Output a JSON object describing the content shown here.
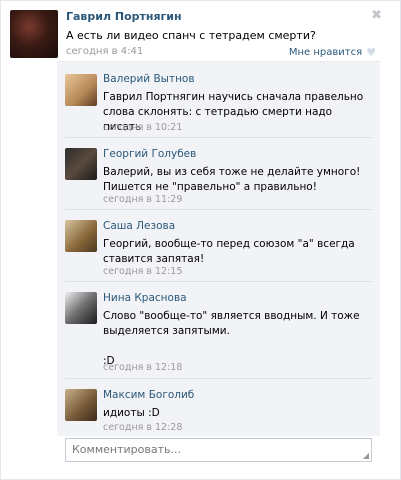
{
  "post": {
    "author": "Гаврил Портнягин",
    "text": "А есть ли видео спанч с тетрадем смерти?",
    "date": "сегодня в 4:41",
    "like_label": "Мне нравится",
    "close_glyph": "✖",
    "heart_glyph": "♥"
  },
  "comments": [
    {
      "author": "Валерий Вытнов",
      "text": "Гаврил Портнягин научись сначала правельно слова склонять: с тетрадью смерти надо писать",
      "date": "сегодня в 10:21"
    },
    {
      "author": "Георгий Голубев",
      "text": "Валерий, вы из себя тоже не делайте умного!\nПишется не \"правельно\" а правильно!",
      "date": "сегодня в 11:29"
    },
    {
      "author": "Саша Лезова",
      "text": "Георгий, вообще-то перед союзом \"а\" всегда ставится запятая!",
      "date": "сегодня в 12:15"
    },
    {
      "author": "Нина Краснова",
      "text": "Слово \"вообще-то\" является вводным. И тоже выделяется запятыми.\n\n:D",
      "date": "сегодня в 12:18"
    },
    {
      "author": "Максим Боголиб",
      "text": "идиоты :D",
      "date": "сегодня в 12:28"
    }
  ],
  "comment_input": {
    "placeholder": "Комментировать..."
  },
  "colors": {
    "link": "#2b587a",
    "meta": "#999999",
    "comments_bg": "#f1f3f6"
  },
  "icons": {
    "close": "close-icon",
    "like": "heart-icon",
    "resize": "resize-handle-icon"
  }
}
